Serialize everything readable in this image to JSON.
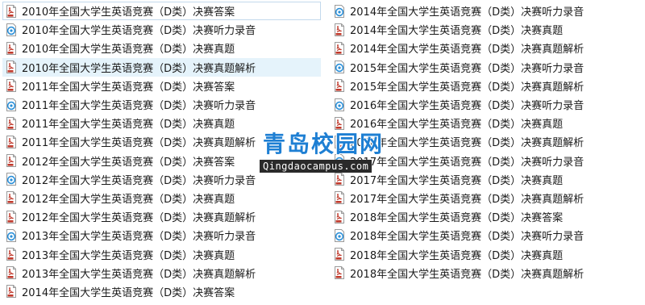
{
  "left_files": [
    {
      "name": "2010年全国大学生英语竞赛（D类）决赛答案",
      "icon": "pdf-icon"
    },
    {
      "name": "2010年全国大学生英语竞赛（D类）决赛听力录音",
      "icon": "audio-icon"
    },
    {
      "name": "2010年全国大学生英语竞赛（D类）决赛真题",
      "icon": "pdf-icon"
    },
    {
      "name": "2010年全国大学生英语竞赛（D类）决赛真题解析",
      "icon": "pdf-icon"
    },
    {
      "name": "2011年全国大学生英语竞赛（D类）决赛答案",
      "icon": "pdf-icon"
    },
    {
      "name": "2011年全国大学生英语竞赛（D类）决赛听力录音",
      "icon": "audio-icon"
    },
    {
      "name": "2011年全国大学生英语竞赛（D类）决赛真题",
      "icon": "pdf-icon"
    },
    {
      "name": "2011年全国大学生英语竞赛（D类）决赛真题解析",
      "icon": "pdf-icon"
    },
    {
      "name": "2012年全国大学生英语竞赛（D类）决赛答案",
      "icon": "pdf-icon"
    },
    {
      "name": "2012年全国大学生英语竞赛（D类）决赛听力录音",
      "icon": "audio-icon"
    },
    {
      "name": "2012年全国大学生英语竞赛（D类）决赛真题",
      "icon": "pdf-icon"
    },
    {
      "name": "2012年全国大学生英语竞赛（D类）决赛真题解析",
      "icon": "pdf-icon"
    },
    {
      "name": "2013年全国大学生英语竞赛（D类）决赛听力录音",
      "icon": "audio-icon"
    },
    {
      "name": "2013年全国大学生英语竞赛（D类）决赛真题",
      "icon": "pdf-icon"
    },
    {
      "name": "2013年全国大学生英语竞赛（D类）决赛真题解析",
      "icon": "pdf-icon"
    },
    {
      "name": "2014年全国大学生英语竞赛（D类）决赛答案",
      "icon": "pdf-icon"
    }
  ],
  "right_files": [
    {
      "name": "2014年全国大学生英语竞赛（D类）决赛听力录音",
      "icon": "audio-icon"
    },
    {
      "name": "2014年全国大学生英语竞赛（D类）决赛真题",
      "icon": "pdf-icon"
    },
    {
      "name": "2014年全国大学生英语竞赛（D类）决赛真题解析",
      "icon": "pdf-icon"
    },
    {
      "name": "2015年全国大学生英语竞赛（D类）决赛听力录音",
      "icon": "audio-icon"
    },
    {
      "name": "2015年全国大学生英语竞赛（D类）决赛真题解析",
      "icon": "pdf-icon"
    },
    {
      "name": "2016年全国大学生英语竞赛（D类）决赛听力录音",
      "icon": "audio-icon"
    },
    {
      "name": "2016年全国大学生英语竞赛（D类）决赛真题",
      "icon": "pdf-icon"
    },
    {
      "name": "2016年全国大学生英语竞赛（D类）决赛真题解析",
      "icon": "pdf-icon"
    },
    {
      "name": "2017年全国大学生英语竞赛（D类）决赛听力录音",
      "icon": "audio-icon"
    },
    {
      "name": "2017年全国大学生英语竞赛（D类）决赛真题",
      "icon": "pdf-icon"
    },
    {
      "name": "2017年全国大学生英语竞赛（D类）决赛真题解析",
      "icon": "pdf-icon"
    },
    {
      "name": "2018年全国大学生英语竞赛（D类）决赛答案",
      "icon": "pdf-icon"
    },
    {
      "name": "2018年全国大学生英语竞赛（D类）决赛听力录音",
      "icon": "audio-icon"
    },
    {
      "name": "2018年全国大学生英语竞赛（D类）决赛真题",
      "icon": "pdf-icon"
    },
    {
      "name": "2018年全国大学生英语竞赛（D类）决赛真题解析",
      "icon": "pdf-icon"
    }
  ],
  "watermark": {
    "title": "青岛校园网",
    "url": "Qingdaocampus.com"
  },
  "colors": {
    "pdf_icon": "#c0392b",
    "audio_icon": "#2a8fd8",
    "hover_bg": "#e5f3fb",
    "focus_border": "#c3d9ec",
    "watermark": "#1e7fd3"
  }
}
